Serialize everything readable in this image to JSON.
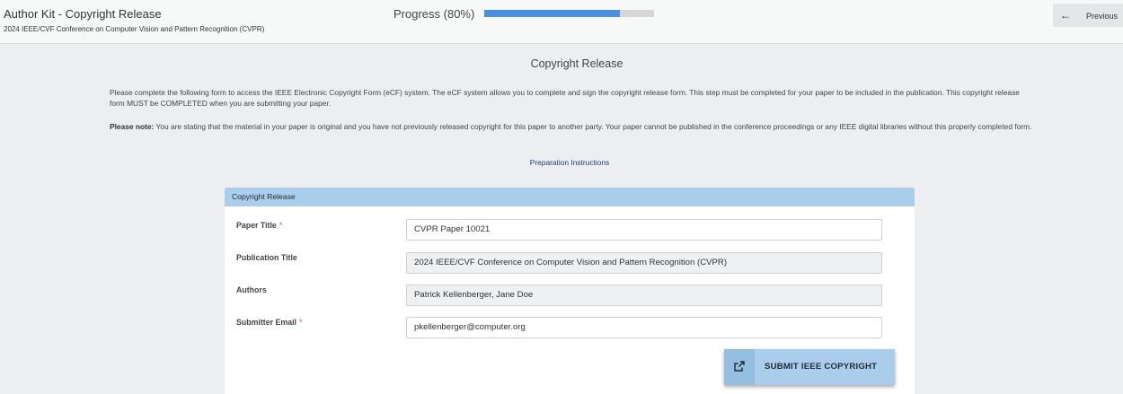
{
  "header": {
    "title": "Author Kit - Copyright Release",
    "subtitle": "2024 IEEE/CVF Conference on Computer Vision and Pattern Recognition (CVPR)",
    "progress_label": "Progress (80%)",
    "progress_value": 0.8,
    "progress_color": "#4a90e2",
    "previous_label": "Previous",
    "previous_icon": "arrow-left-icon"
  },
  "main": {
    "title": "Copyright Release",
    "para1": "Please complete the following form to access the IEEE Electronic Copyright Form (eCF) system. The eCF system allows you to complete and sign the copyright release form. This step must be completed for your paper to be included in the publication. This copyright release form MUST be COMPLETED when you are submitting your paper.",
    "note_bold": "Please note:",
    "note_text": " You are stating that the material in your paper is original and you have not previously released copyright for this paper to another party. Your paper cannot be published in the conference proceedings or any IEEE digital libraries without this properly completed form.",
    "prep_link": "Preparation Instructions"
  },
  "form": {
    "header": "Copyright Release",
    "required_mark": "*",
    "fields": [
      {
        "label": "Paper Title",
        "value": "CVPR Paper 10021",
        "required": true
      },
      {
        "label": "Publication Title",
        "value": "2024 IEEE/CVF Conference on Computer Vision and Pattern Recognition (CVPR)",
        "required": false
      },
      {
        "label": "Authors",
        "value": "Patrick Kellenberger, Jane Doe",
        "required": false
      },
      {
        "label": "Submitter Email",
        "value": "pkellenberger@computer.org",
        "required": true
      }
    ],
    "submit_label": "SUBMIT IEEE COPYRIGHT",
    "submit_icon": "external-link-icon",
    "accent_color": "#a9cdea"
  }
}
